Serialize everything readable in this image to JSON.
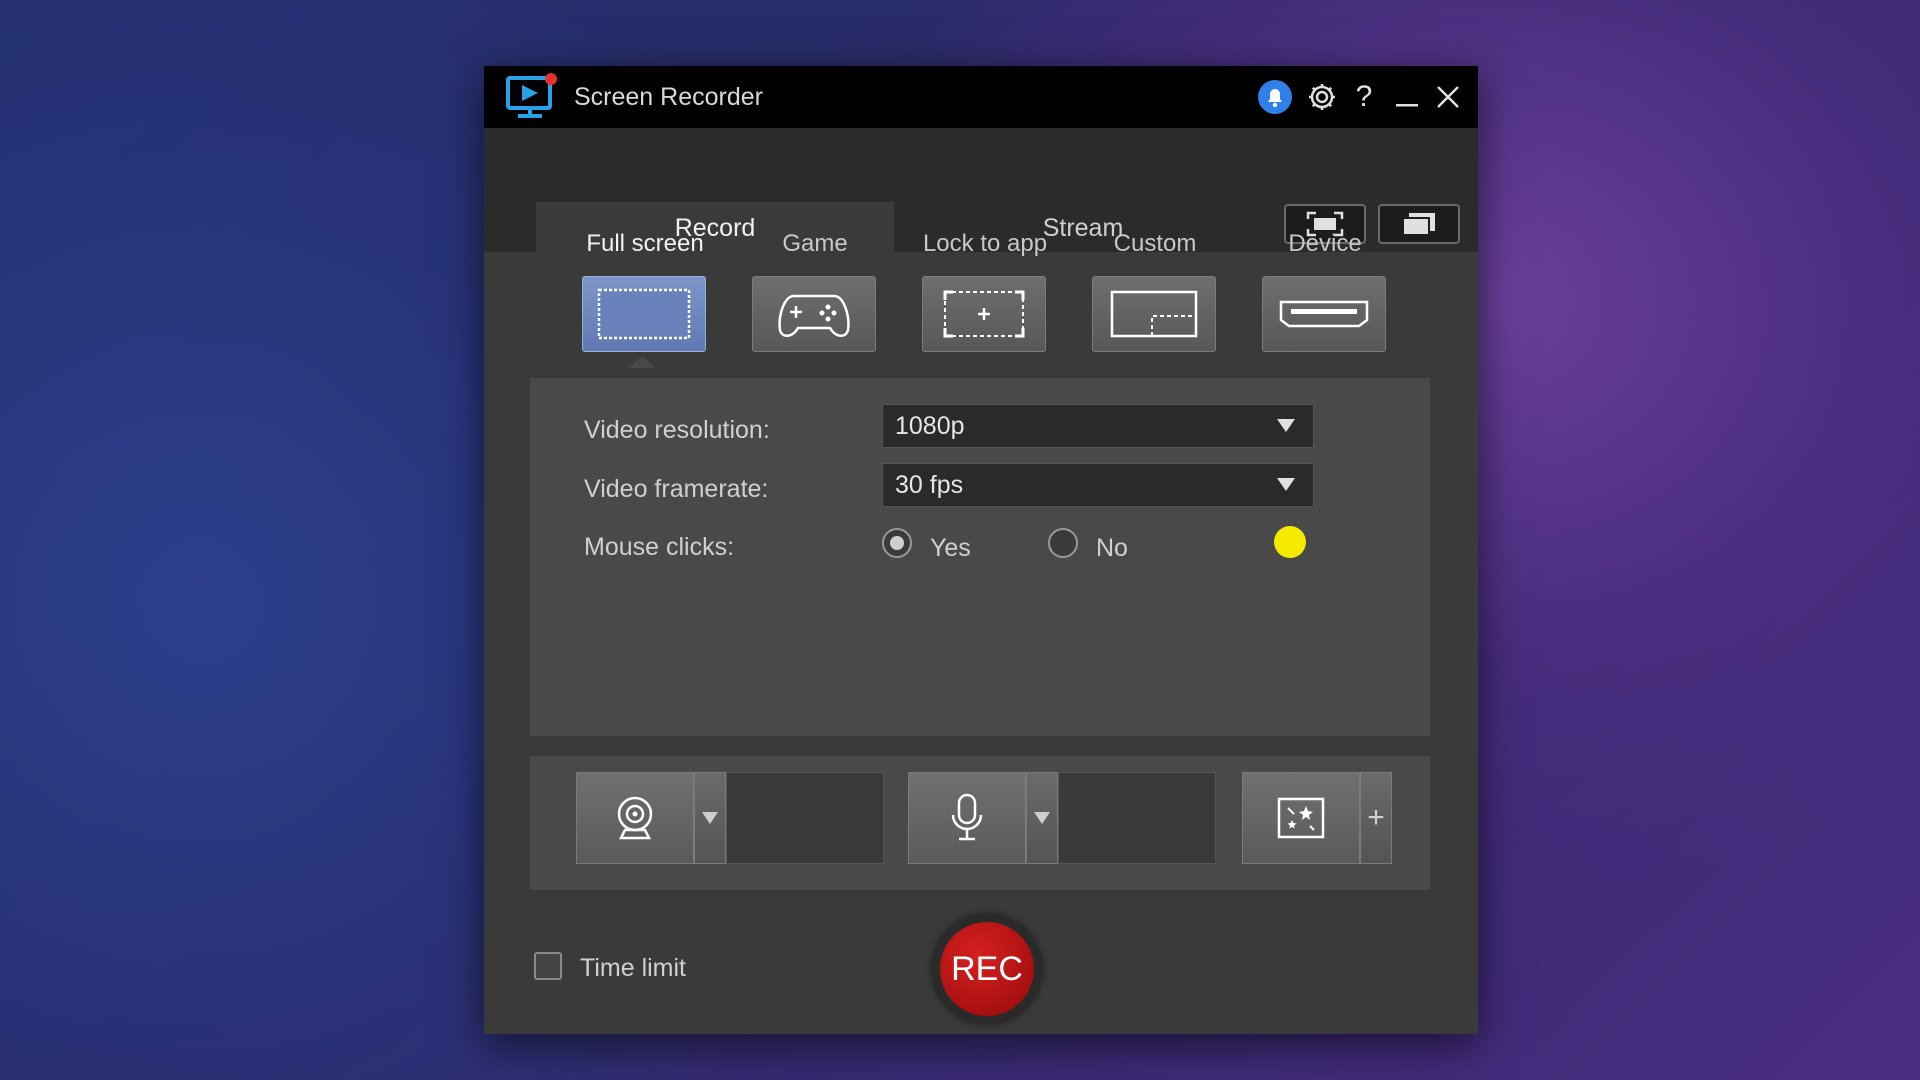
{
  "window": {
    "title": "Screen Recorder"
  },
  "tabs": [
    {
      "label": "Record",
      "active": true
    },
    {
      "label": "Stream",
      "active": false
    }
  ],
  "modes": [
    {
      "label": "Full screen",
      "active": true,
      "icon": "fullscreen-icon"
    },
    {
      "label": "Game",
      "active": false,
      "icon": "gamepad-icon"
    },
    {
      "label": "Lock to app",
      "active": false,
      "icon": "lock-to-app-icon"
    },
    {
      "label": "Custom",
      "active": false,
      "icon": "custom-area-icon"
    },
    {
      "label": "Device",
      "active": false,
      "icon": "device-icon"
    }
  ],
  "settings": {
    "resolution_label": "Video resolution:",
    "resolution_value": "1080p",
    "framerate_label": "Video framerate:",
    "framerate_value": "30 fps",
    "mouse_clicks_label": "Mouse clicks:",
    "mouse_yes": "Yes",
    "mouse_no": "No",
    "mouse_selected": "Yes",
    "click_color": "#f4ea00"
  },
  "input_devices": [
    {
      "icon": "webcam-icon"
    },
    {
      "icon": "microphone-icon"
    },
    {
      "icon": "effects-icon"
    }
  ],
  "footer": {
    "time_limit_label": "Time limit",
    "time_limit_checked": false,
    "rec_label": "REC"
  },
  "colors": {
    "accent": "#2f80e8",
    "rec": "#b01212",
    "active_mode": "#6f86bd"
  }
}
